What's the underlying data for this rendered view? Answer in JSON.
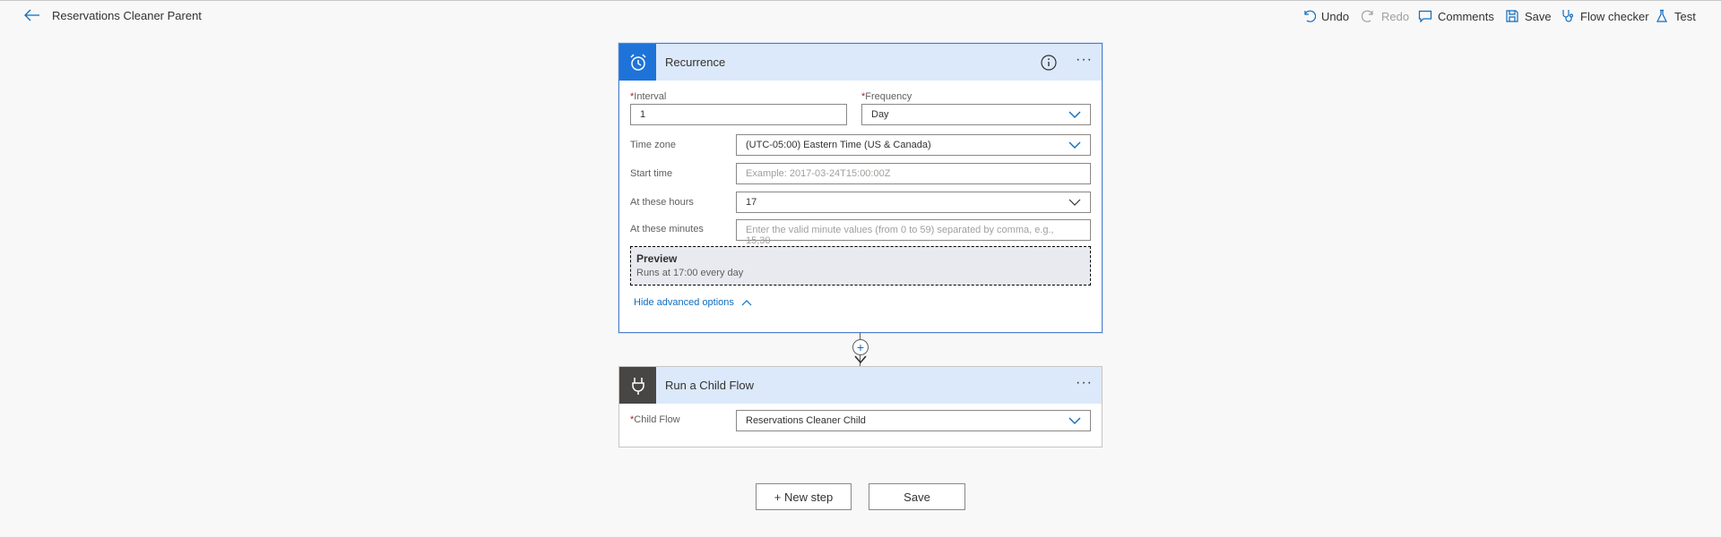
{
  "header": {
    "title": "Reservations Cleaner Parent",
    "commands": {
      "undo": "Undo",
      "redo": "Redo",
      "comments": "Comments",
      "save": "Save",
      "flow_checker": "Flow checker",
      "test": "Test"
    }
  },
  "recurrence": {
    "title": "Recurrence",
    "interval_label": "Interval",
    "interval_value": "1",
    "frequency_label": "Frequency",
    "frequency_value": "Day",
    "timezone_label": "Time zone",
    "timezone_value": "(UTC-05:00) Eastern Time (US & Canada)",
    "start_time_label": "Start time",
    "start_time_placeholder": "Example: 2017-03-24T15:00:00Z",
    "hours_label": "At these hours",
    "hours_value": "17",
    "minutes_label": "At these minutes",
    "minutes_placeholder": "Enter the valid minute values (from 0 to 59) separated by comma, e.g., 15,30",
    "preview_title": "Preview",
    "preview_text": "Runs at 17:00 every day",
    "hide_advanced": "Hide advanced options",
    "required_mark": "*"
  },
  "child_flow": {
    "title": "Run a Child Flow",
    "field_label": "Child Flow",
    "field_value": "Reservations Cleaner Child",
    "required_mark": "*"
  },
  "footer": {
    "new_step": "+ New step",
    "save": "Save"
  },
  "colors": {
    "accent": "#0f6cbd",
    "card_header": "#dce9fa",
    "recurrence_icon_bg": "#1e73d9",
    "child_icon_bg": "#484644"
  }
}
